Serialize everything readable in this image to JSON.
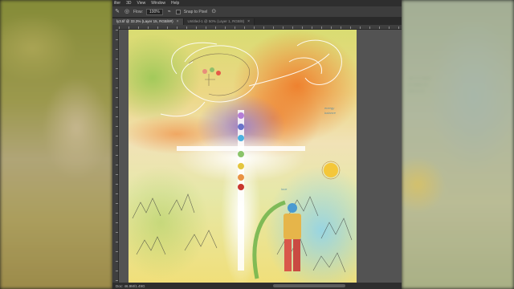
{
  "app": {
    "menu": [
      "ilter",
      "3D",
      "View",
      "Window",
      "Help"
    ]
  },
  "options": {
    "flow_label": "Flow:",
    "flow_value": "100%",
    "checkbox_label": "Snap to Pixel"
  },
  "tabs": [
    {
      "label": "ly3.tif @ 33.3% (Layer 15, RGB/8#)",
      "active": true
    },
    {
      "label": "Untitled-1 @ 50% (Layer 1, RGB/8)",
      "active": false
    }
  ],
  "status": {
    "doc_info": "Doc: 46.9M/1.49G"
  },
  "canvas": {
    "notes": [
      "energy",
      "balance",
      "love"
    ]
  },
  "colors": {
    "chakra_crown": "#b57dd6",
    "chakra_third_eye": "#6a73c9",
    "chakra_throat": "#4bb0e0",
    "chakra_heart": "#8bc46a",
    "chakra_solar": "#e4c63f",
    "chakra_sacral": "#e99343",
    "chakra_root": "#c8372e",
    "sun": "#f4c73a"
  }
}
